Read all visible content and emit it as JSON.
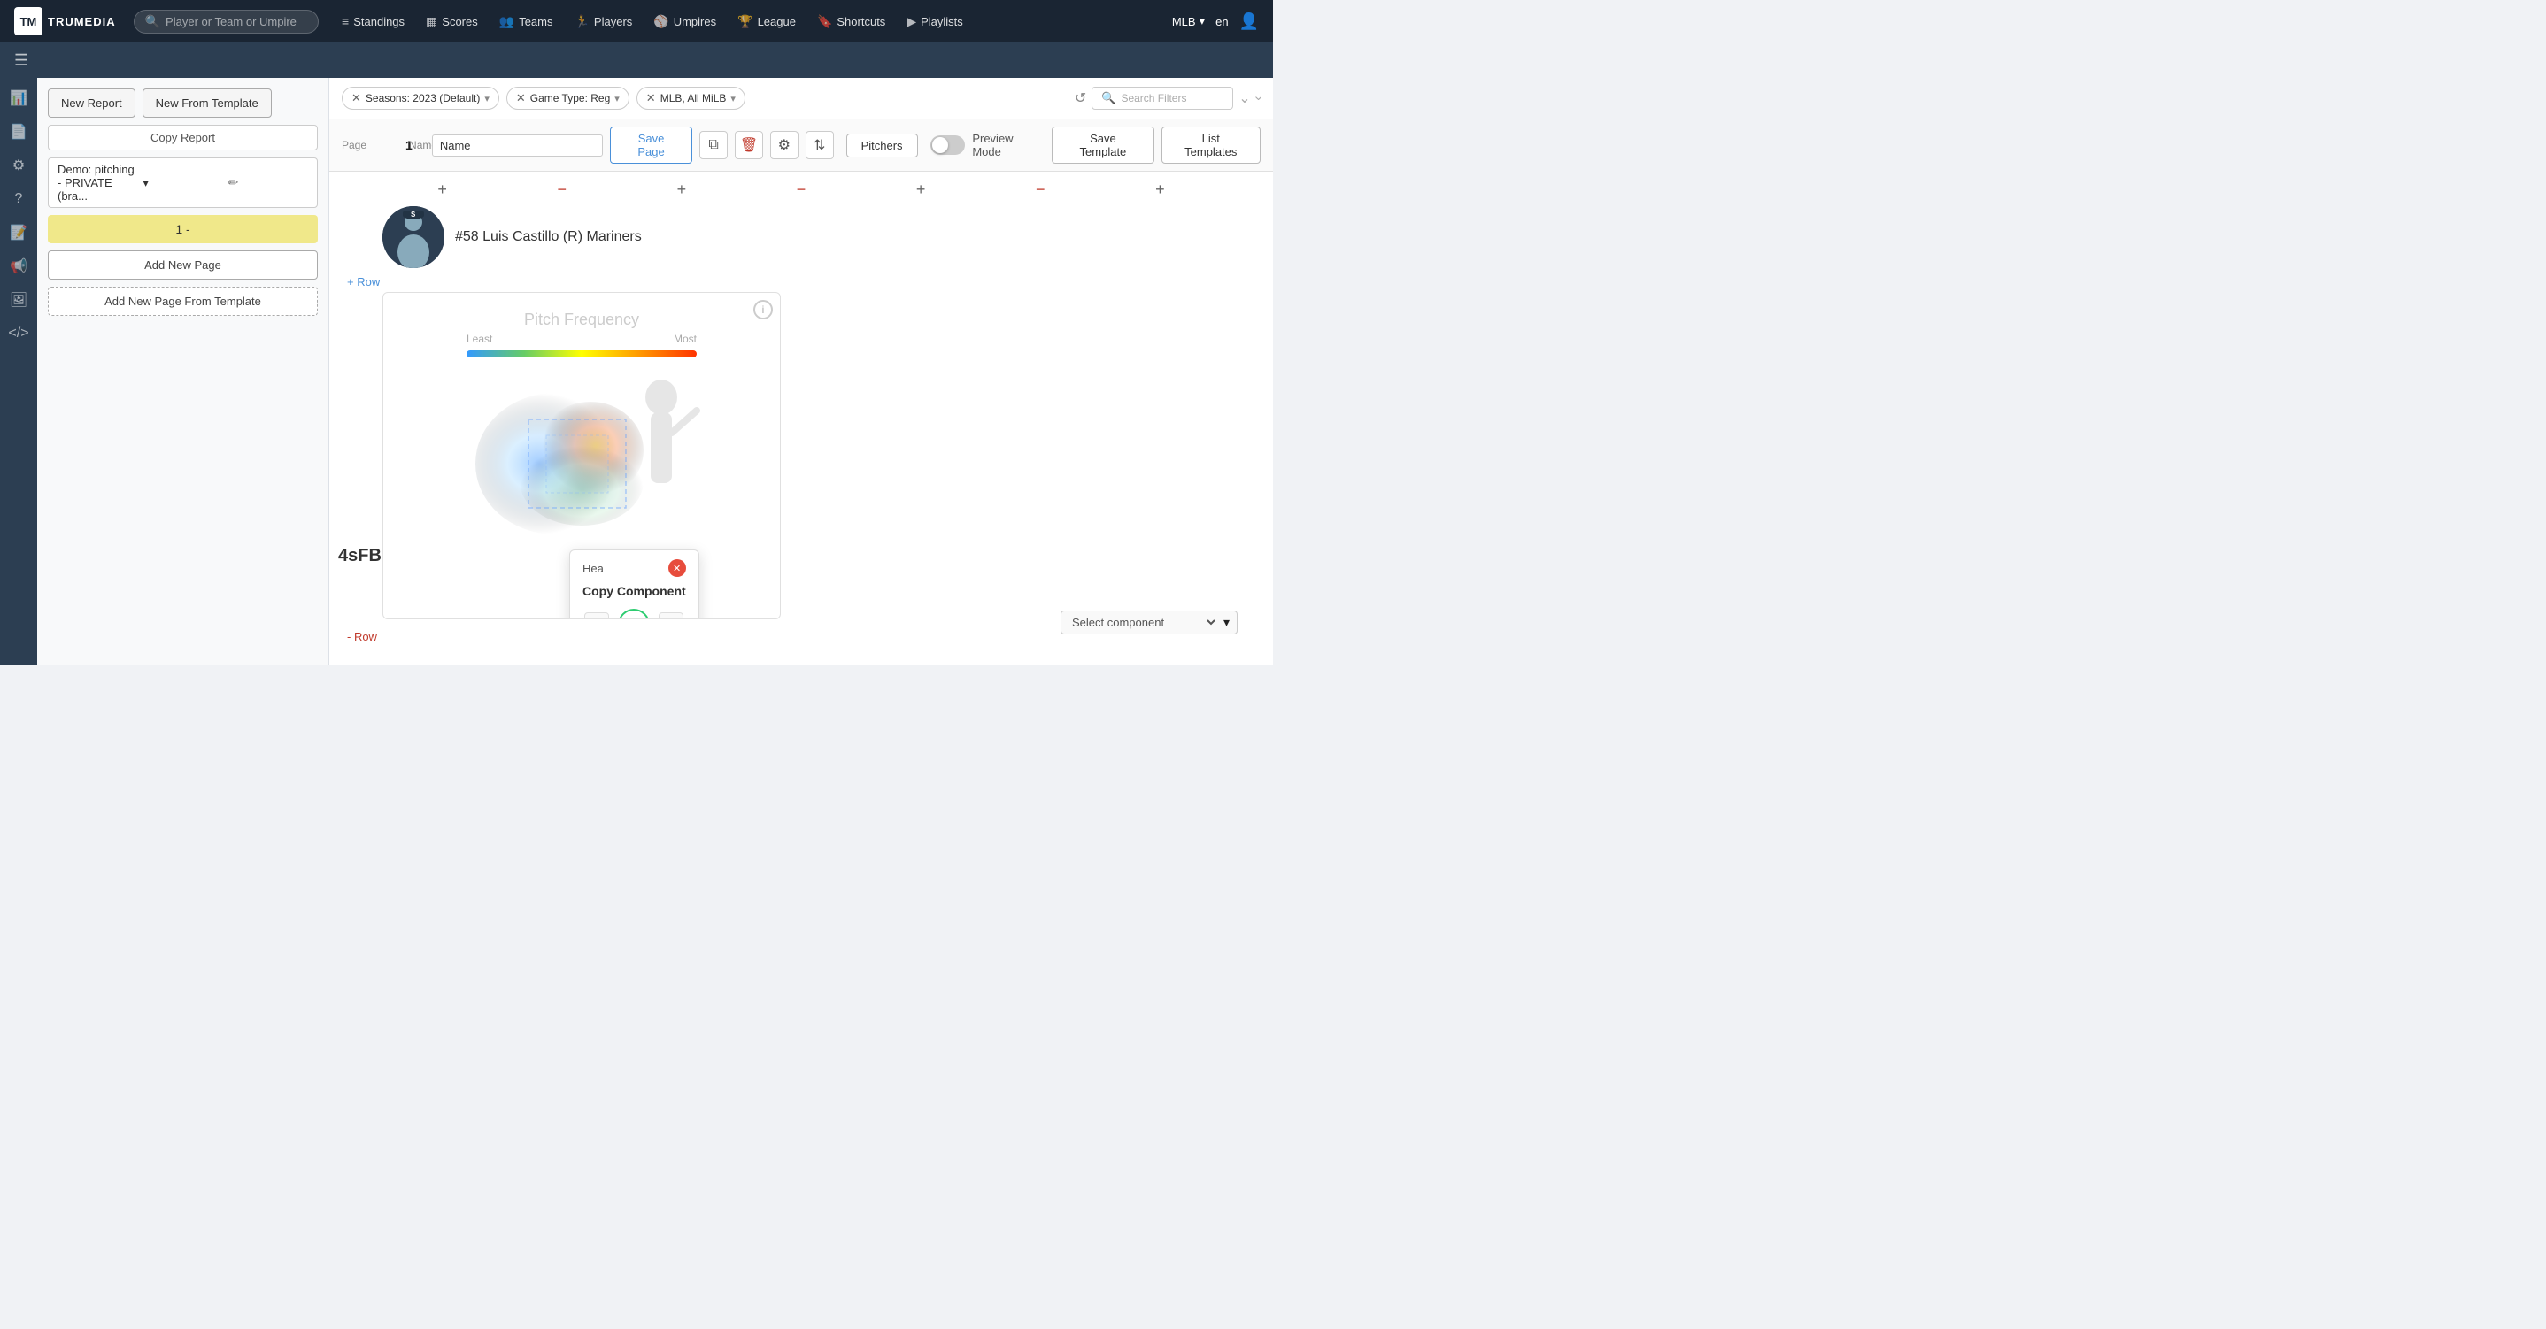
{
  "app": {
    "logo_tm": "TM",
    "logo_text": "TRUMEDIA"
  },
  "topnav": {
    "search_placeholder": "Player or Team or Umpire",
    "items": [
      {
        "label": "Standings",
        "icon": "≡"
      },
      {
        "label": "Scores",
        "icon": "▦"
      },
      {
        "label": "Teams",
        "icon": "👥"
      },
      {
        "label": "Players",
        "icon": "🏃"
      },
      {
        "label": "Umpires",
        "icon": "⚾"
      },
      {
        "label": "League",
        "icon": "🏆"
      },
      {
        "label": "Shortcuts",
        "icon": "🔖"
      },
      {
        "label": "Playlists",
        "icon": "▶"
      }
    ],
    "league": "MLB",
    "lang": "en"
  },
  "left_panel": {
    "new_report_label": "New Report",
    "new_from_template_label": "New From Template",
    "copy_report_label": "Copy Report",
    "report_name": "Demo: pitching - PRIVATE (bra...",
    "page_display": "1 -",
    "add_new_page_label": "Add New Page",
    "add_new_page_template_label": "Add New Page From Template"
  },
  "filter_bar": {
    "filters": [
      {
        "label": "Seasons: 2023 (Default)"
      },
      {
        "label": "Game Type: Reg"
      },
      {
        "label": "MLB, All MiLB"
      }
    ],
    "search_filters_placeholder": "Search Filters"
  },
  "page_editor": {
    "page_col_label": "Page",
    "name_col_label": "Name",
    "page_num": "1",
    "name_value": "Name",
    "save_page_label": "Save Page",
    "pitchers_label": "Pitchers",
    "preview_mode_label": "Preview Mode",
    "save_template_label": "Save Template",
    "list_templates_label": "List Templates"
  },
  "report_area": {
    "player_name": "#58 Luis Castillo (R) Mariners",
    "add_row_label": "+ Row",
    "remove_row_label": "- Row",
    "pitch_freq_title": "Pitch Frequency",
    "legend_least": "Least",
    "legend_most": "Most",
    "pitch_label": "4sFB",
    "heatmap_label": "Hea",
    "copy_component_title": "Copy Component",
    "select_component_placeholder": "Select component"
  }
}
